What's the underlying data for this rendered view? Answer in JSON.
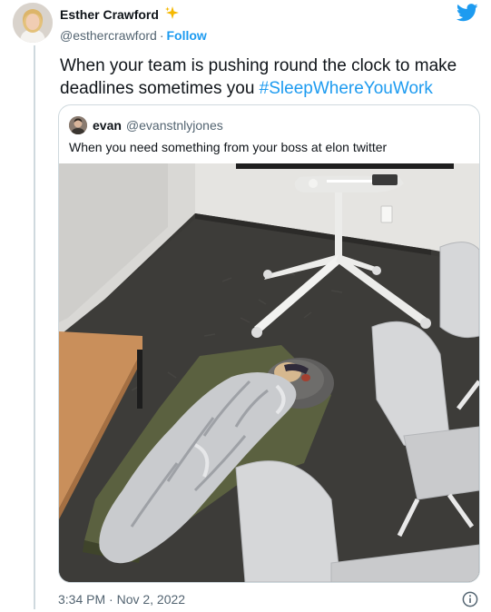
{
  "tweet": {
    "author_name": "Esther Crawford",
    "author_handle": "@esthercrawford",
    "separator": "·",
    "follow_label": "Follow",
    "text_before": "When your team is pushing round the clock to make deadlines sometimes you ",
    "hashtag": "#SleepWhereYouWork",
    "timestamp": "3:34 PM · Nov 2, 2022",
    "icons": [
      "sparkle-icon",
      "twitter-bird-icon",
      "info-icon"
    ]
  },
  "quote_tweet": {
    "author_name": "evan",
    "author_handle": "@evanstnlyjones",
    "text": "When you need something from your boss at elon twitter",
    "media_description_colors": {
      "carpet": "#3b3a37",
      "wall": "#e3e2df",
      "sleeping_bag": "#c9cbce",
      "mat": "#5b6140",
      "table": "#c98f5b"
    }
  },
  "colors": {
    "link": "#1d9bf0",
    "secondary_text": "#536471",
    "border": "#cfd9de",
    "text": "#0f1419"
  }
}
